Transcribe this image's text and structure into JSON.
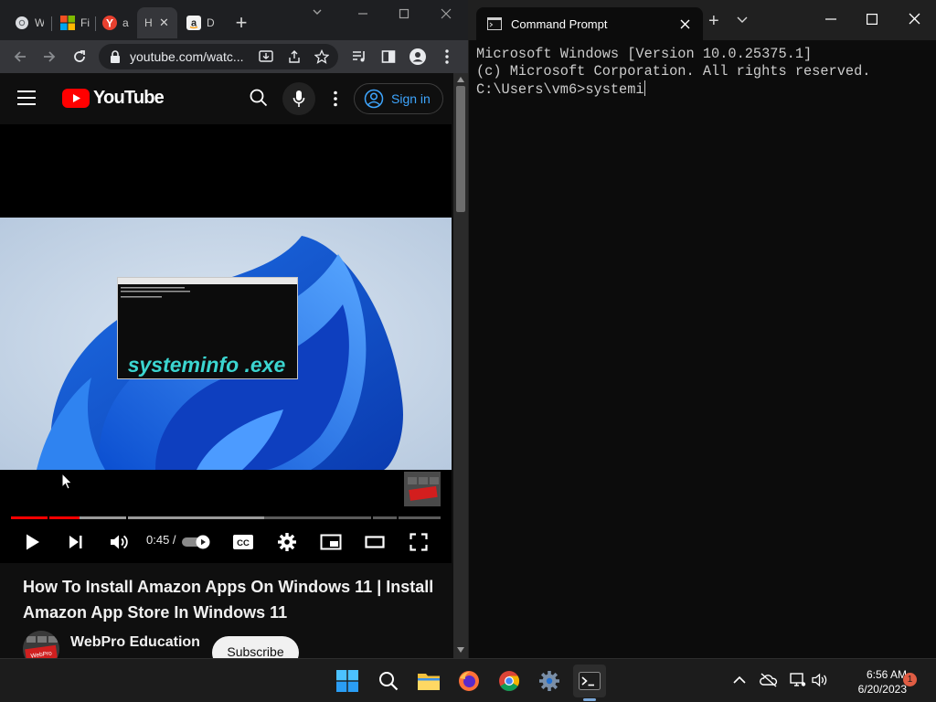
{
  "chrome": {
    "tabs": [
      {
        "label": "W",
        "icon": "chrome-icon"
      },
      {
        "label": "Fi",
        "icon": "microsoft-icon"
      },
      {
        "label": "a",
        "icon": "y-icon"
      },
      {
        "label": "H",
        "icon": "none",
        "active": true
      },
      {
        "label": "D",
        "icon": "amazon-icon"
      }
    ],
    "close_tab_glyph": "✕",
    "new_tab_glyph": "+",
    "url": "youtube.com/watc..."
  },
  "youtube": {
    "logo_text": "YouTube",
    "sign_in_label": "Sign in",
    "overlay_text": "systeminfo .exe",
    "time_text": "0:45 /",
    "progress_played_fraction": 0.16,
    "progress_buffered_fraction": 0.59,
    "video_title": "How To Install Amazon Apps On Windows 11 | Install Amazon App Store In Windows 11",
    "channel_name": "WebPro Education",
    "subscribe_label": "Subscribe",
    "cc_label": "CC",
    "avatar_text": "WebPro"
  },
  "terminal": {
    "tab_title": "Command Prompt",
    "new_tab_glyph": "+",
    "lines": [
      "Microsoft Windows [Version 10.0.25375.1]",
      "(c) Microsoft Corporation. All rights reserved.",
      "",
      "C:\\Users\\vm6>systemi"
    ]
  },
  "taskbar": {
    "time": "6:56 AM",
    "date": "6/20/2023",
    "notification_count": "1",
    "apps": [
      "start",
      "search",
      "file-explorer",
      "firefox",
      "chrome",
      "settings",
      "terminal"
    ]
  },
  "colors": {
    "youtube_red": "#ff0000",
    "sign_in_blue": "#3ea6ff",
    "terminal_bg": "#0c0c0c",
    "overlay_cyan": "#3bd5d0"
  }
}
